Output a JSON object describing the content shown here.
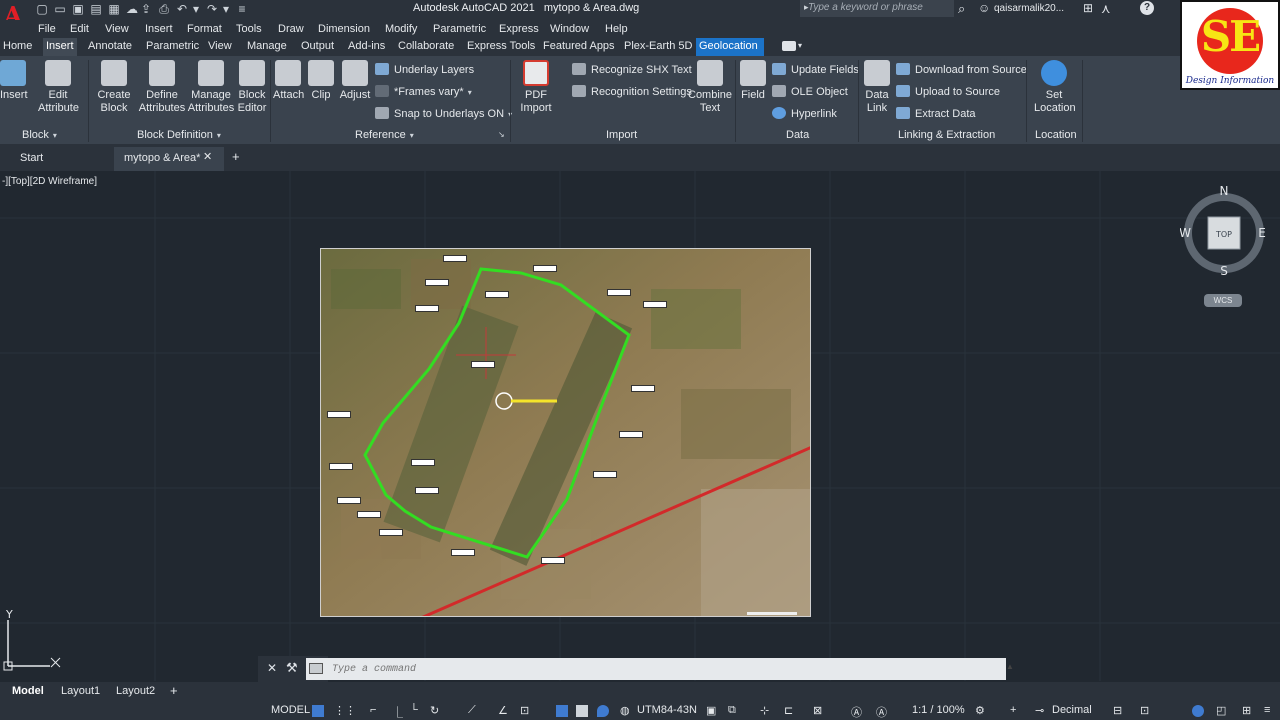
{
  "titlebar": {
    "app_title": "Autodesk AutoCAD 2021",
    "file_name": "mytopo & Area.dwg",
    "search_placeholder": "Type a keyword or phrase",
    "user_name": "qaisarmalik20..."
  },
  "menu": [
    "File",
    "Edit",
    "View",
    "Insert",
    "Format",
    "Tools",
    "Draw",
    "Dimension",
    "Modify",
    "Parametric",
    "Express",
    "Window",
    "Help"
  ],
  "ribbon_tabs": [
    "Home",
    "Insert",
    "Annotate",
    "Parametric",
    "View",
    "Manage",
    "Output",
    "Add-ins",
    "Collaborate",
    "Express Tools",
    "Featured Apps",
    "Plex-Earth 5D",
    "Geolocation"
  ],
  "active_ribbon_tab": "Insert",
  "ribbon": {
    "block": {
      "title": "Block",
      "insert": "Insert",
      "edit_attr_1": "Edit",
      "edit_attr_2": "Attribute"
    },
    "block_def": {
      "title": "Block Definition",
      "create_1": "Create",
      "create_2": "Block",
      "define_1": "Define",
      "define_2": "Attributes",
      "manage_1": "Manage",
      "manage_2": "Attributes",
      "editor_1": "Block",
      "editor_2": "Editor"
    },
    "reference": {
      "title": "Reference",
      "attach": "Attach",
      "clip": "Clip",
      "adjust": "Adjust",
      "underlay_layers": "Underlay Layers",
      "frames_vary": "*Frames vary*",
      "snap_underlays": "Snap to Underlays ON"
    },
    "import": {
      "title": "Import",
      "pdf_1": "PDF",
      "pdf_2": "Import",
      "recognize_shx": "Recognize SHX Text",
      "recognition_settings": "Recognition Settings",
      "combine_1": "Combine",
      "combine_2": "Text"
    },
    "data": {
      "title": "Data",
      "field": "Field",
      "update_fields": "Update Fields",
      "ole_object": "OLE Object",
      "hyperlink": "Hyperlink"
    },
    "linking": {
      "title": "Linking & Extraction",
      "data_link_1": "Data",
      "data_link_2": "Link",
      "download": "Download from Source",
      "upload": "Upload to Source",
      "extract": "Extract  Data"
    },
    "location": {
      "title": "Location",
      "set_1": "Set",
      "set_2": "Location"
    }
  },
  "doc_tabs": {
    "start": "Start",
    "active": "mytopo & Area*"
  },
  "viewport": {
    "label": "-][Top][2D Wireframe]",
    "compass": {
      "n": "N",
      "s": "S",
      "e": "E",
      "w": "W",
      "cube_face": "TOP"
    },
    "wcs": "WCS",
    "ucs_y": "Y"
  },
  "command": {
    "placeholder": "Type a command"
  },
  "layout_tabs": [
    "Model",
    "Layout1",
    "Layout2"
  ],
  "status": {
    "model": "MODEL",
    "coord_system": "UTM84-43N",
    "scale": "1:1 / 100%",
    "units": "Decimal"
  },
  "watermark": {
    "letters": "SE",
    "tagline": "Design Information"
  },
  "colors": {
    "accent": "#1b73c8",
    "boundary": "#33dd22",
    "road": "#d22a2a",
    "background": "#212830"
  }
}
